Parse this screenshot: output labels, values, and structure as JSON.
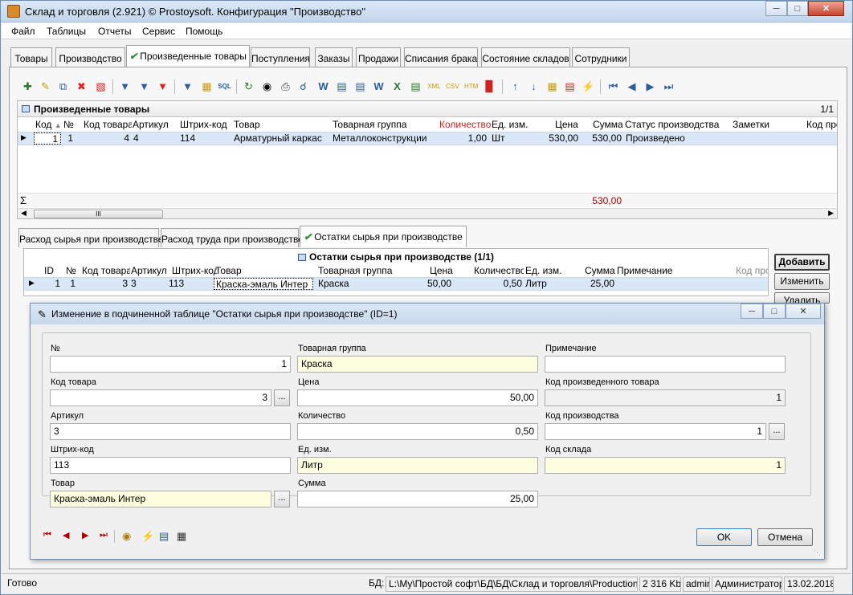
{
  "window": {
    "title": "Склад и торговля (2.921) © Prostoysoft. Конфигурация \"Производство\""
  },
  "menu": [
    "Файл",
    "Таблицы",
    "Отчеты",
    "Сервис",
    "Помощь"
  ],
  "tabs": [
    "Товары",
    "Производство",
    "Произведенные товары",
    "Поступления",
    "Заказы",
    "Продажи",
    "Списания брака",
    "Состояние складов",
    "Сотрудники"
  ],
  "active_tab": "Произведенные товары",
  "toolbar_icons": [
    "add-icon",
    "edit-icon",
    "copy-icon",
    "delete-icon",
    "delete-all-icon",
    "filter-icon",
    "filter-add-icon",
    "filter-clear-icon",
    "filter-advanced-icon",
    "filter-group-icon",
    "sql-icon",
    "refresh-icon",
    "find-icon",
    "print-icon",
    "preview-icon",
    "export-word-icon",
    "export-doc-icon",
    "export-rtf-icon",
    "export-word2-icon",
    "export-excel-icon",
    "export-xls-icon",
    "export-xml-icon",
    "export-csv-icon",
    "export-html-icon",
    "chart-icon",
    "sort-asc-icon",
    "sort-desc-icon",
    "columns-icon",
    "fields-icon",
    "lightning-icon",
    "first-record-icon",
    "prev-record-icon",
    "next-record-icon",
    "last-record-icon"
  ],
  "main_grid": {
    "title": "Произведенные товары",
    "page": "1/1",
    "columns": [
      "Код",
      "№",
      "Код товара",
      "Артикул",
      "Штрих-код",
      "Товар",
      "Товарная группа",
      "Количество",
      "Ед. изм.",
      "Цена",
      "Сумма",
      "Статус производства",
      "Заметки",
      "Код про"
    ],
    "rows": [
      [
        "1",
        "1",
        "4",
        "4",
        "114",
        "Арматурный каркас",
        "Металлоконструкции",
        "1,00",
        "Шт",
        "530,00",
        "530,00",
        "Произведено",
        "",
        ""
      ]
    ],
    "sigma": "Σ",
    "total": "530,00",
    "scroll_thumb": "III"
  },
  "subtabs": [
    "Расход сырья при производстве",
    "Расход труда при производстве",
    "Остатки сырья при производстве"
  ],
  "active_subtab": "Остатки сырья при производстве",
  "sub_grid": {
    "title": "Остатки сырья при производстве (1/1)",
    "columns": [
      "ID",
      "№",
      "Код товара",
      "Артикул",
      "Штрих-код",
      "Товар",
      "Товарная группа",
      "Цена",
      "Количество",
      "Ед. изм.",
      "Сумма",
      "Примечание",
      "Код про"
    ],
    "rows": [
      [
        "1",
        "1",
        "3",
        "3",
        "113",
        "Краска-эмаль Интер",
        "Краска",
        "50,00",
        "0,50",
        "Литр",
        "25,00",
        "",
        ""
      ]
    ]
  },
  "side_buttons": [
    "Добавить",
    "Изменить",
    "Удалить"
  ],
  "dialog": {
    "title": "Изменение в подчиненной таблице \"Остатки сырья при производстве\" (ID=1)",
    "fields": {
      "no": {
        "label": "№",
        "value": "1"
      },
      "code": {
        "label": "Код товара",
        "value": "3"
      },
      "article": {
        "label": "Артикул",
        "value": "3"
      },
      "barcode": {
        "label": "Штрих-код",
        "value": "113"
      },
      "product": {
        "label": "Товар",
        "value": "Краска-эмаль Интер"
      },
      "group": {
        "label": "Товарная группа",
        "value": "Краска"
      },
      "price": {
        "label": "Цена",
        "value": "50,00"
      },
      "qty": {
        "label": "Количество",
        "value": "0,50"
      },
      "unit": {
        "label": "Ед. изм.",
        "value": "Литр"
      },
      "sum": {
        "label": "Сумма",
        "value": "25,00"
      },
      "note": {
        "label": "Примечание",
        "value": ""
      },
      "made_code": {
        "label": "Код произведенного товара",
        "value": "1"
      },
      "prod_code": {
        "label": "Код производства",
        "value": "1"
      },
      "store_code": {
        "label": "Код склада",
        "value": "1"
      }
    },
    "ellipsis": "...",
    "ok": "OK",
    "cancel": "Отмена"
  },
  "status": {
    "ready": "Готово",
    "db_label": "БД:",
    "db_path": "L:\\My\\Простой софт\\БД\\БД\\Склад и торговля\\Production.mdb",
    "size": "2 316 Kb",
    "user": "admin",
    "role": "Администратор",
    "date": "13.02.2018"
  }
}
